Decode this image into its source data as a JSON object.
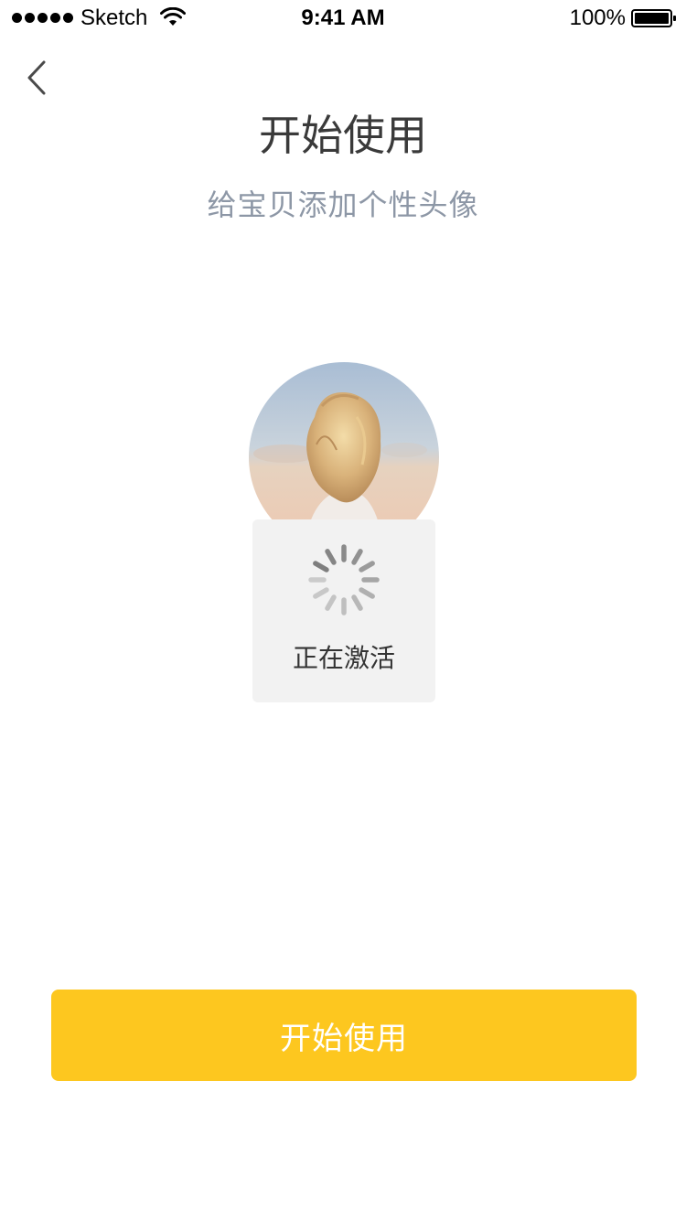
{
  "status_bar": {
    "carrier": "Sketch",
    "time": "9:41 AM",
    "battery": "100%",
    "wifi_icon": "wifi-icon",
    "battery_icon": "battery-full-icon"
  },
  "nav": {
    "back_icon": "chevron-left-icon"
  },
  "header": {
    "title": "开始使用",
    "subtitle": "给宝贝添加个性头像"
  },
  "avatar": {
    "icon": "child-photo"
  },
  "loading": {
    "icon": "spinner-icon",
    "text": "正在激活"
  },
  "primary_button": {
    "label": "开始使用",
    "color": "#fdc71f"
  },
  "colors": {
    "title": "#3a3a3a",
    "subtitle": "#8d97a6",
    "toast_bg": "#f2f2f2",
    "accent": "#fdc71f"
  }
}
